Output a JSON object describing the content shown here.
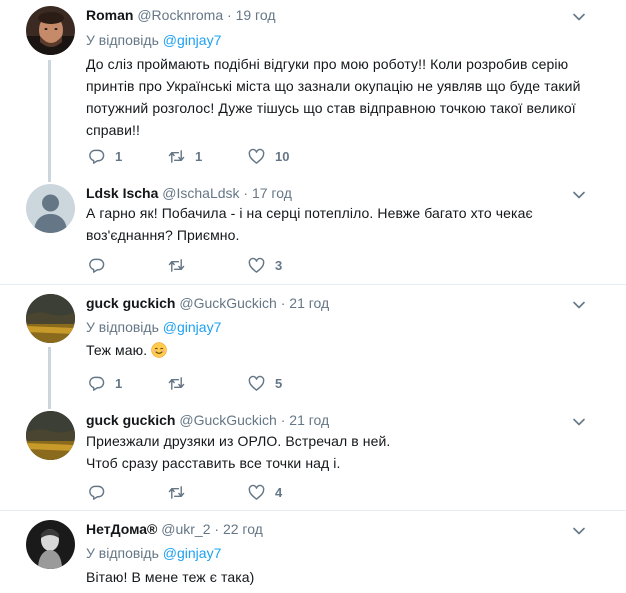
{
  "tweets": [
    {
      "name": "Roman",
      "handle": "@Rocknroma",
      "dot": "·",
      "time": "19 год",
      "replying_prefix": "У відповідь",
      "replying_to": "@ginjay7",
      "text": "До сліз проймають подібні відгуки про мою роботу!! Коли розробив серію принтів про Українські міста що зазнали окупацію не уявляв що буде такий потужний розголос! Дуже тішусь  що став відправною точкою такої великої справи!!",
      "replies": "1",
      "retweets": "1",
      "likes": "10"
    },
    {
      "name": "Ldsk Ischa",
      "handle": "@IschaLdsk",
      "dot": "·",
      "time": "17 год",
      "text": "А гарно як! Побачила - і на серці потепліло. Невже багато хто чекає воз'єднання? Приємно.",
      "replies": "",
      "retweets": "",
      "likes": "3"
    },
    {
      "name": "guck guckich",
      "handle": "@GuckGuckich",
      "dot": "·",
      "time": "21 год",
      "replying_prefix": "У відповідь",
      "replying_to": "@ginjay7",
      "text": "Теж маю.",
      "emoji": "smiling-face-emoji",
      "replies": "1",
      "retweets": "",
      "likes": "5"
    },
    {
      "name": "guck guckich",
      "handle": "@GuckGuckich",
      "dot": "·",
      "time": "21 год",
      "text_line1": "Приезжали друзяки из ОРЛО. Встречал в ней.",
      "text_line2": "Чтоб сразу расставить все точки над і.",
      "replies": "",
      "retweets": "",
      "likes": "4"
    },
    {
      "name": "НетДома®",
      "handle": "@ukr_2",
      "dot": "·",
      "time": "22 год",
      "replying_prefix": "У відповідь",
      "replying_to": "@ginjay7",
      "text": "Вітаю! В мене теж є така)"
    }
  ],
  "colors": {
    "link": "#1da1f2",
    "secondary_text": "#657786",
    "thread_line": "#ccd6dd",
    "divider": "#e6ecf0"
  },
  "icons": [
    "reply-icon",
    "retweet-icon",
    "like-icon",
    "caret-down-icon"
  ]
}
